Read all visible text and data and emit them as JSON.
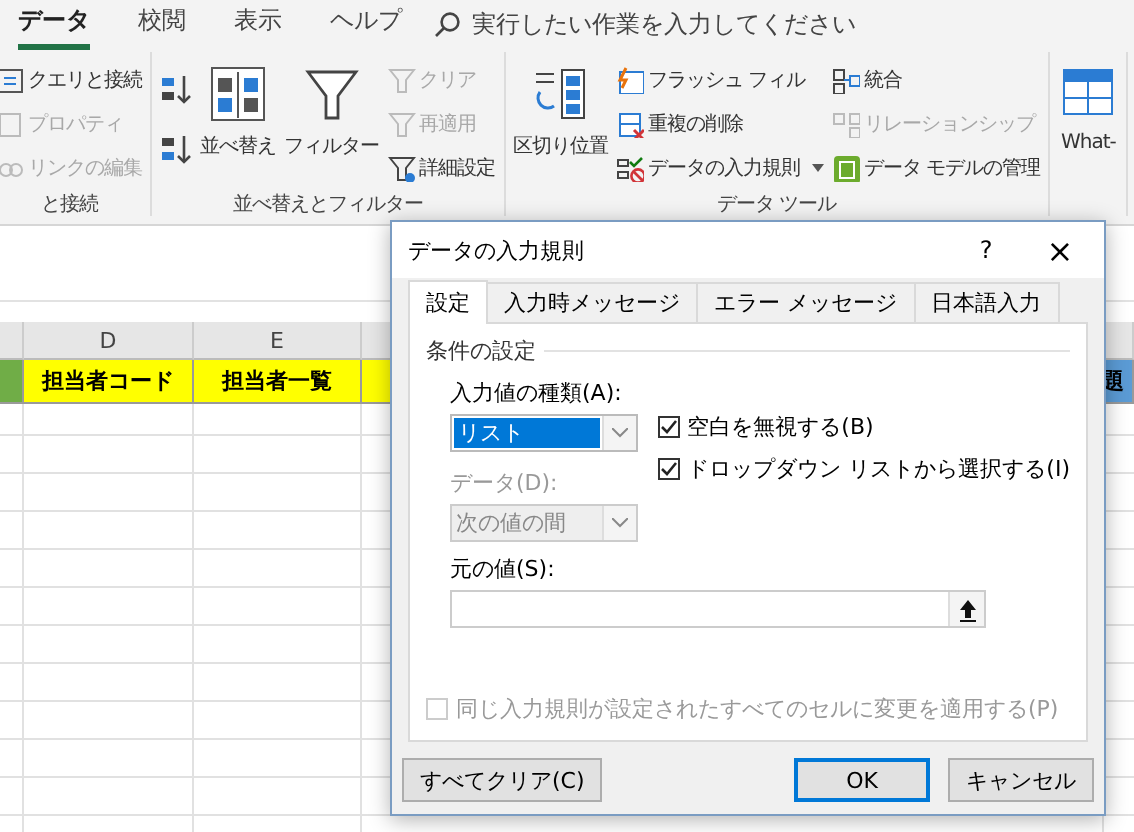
{
  "menu_tabs": [
    {
      "label": "データ",
      "selected": true
    },
    {
      "label": "校閲",
      "selected": false
    },
    {
      "label": "表示",
      "selected": false
    },
    {
      "label": "ヘルプ",
      "selected": false
    }
  ],
  "search": {
    "placeholder": "実行したい作業を入力してください"
  },
  "ribbon": {
    "groups": [
      {
        "label": "と接続",
        "columns": [
          {
            "kind": "stack",
            "items": [
              {
                "label": "クエリと接続",
                "disabled": false
              },
              {
                "label": "プロパティ",
                "disabled": true
              },
              {
                "label": "リンクの編集",
                "disabled": true
              }
            ]
          }
        ]
      },
      {
        "label": "並べ替えとフィルター",
        "columns": [
          {
            "kind": "icon_pair"
          },
          {
            "kind": "large",
            "label": "並べ替え"
          },
          {
            "kind": "large",
            "label": "フィルター"
          },
          {
            "kind": "stack",
            "items": [
              {
                "label": "クリア",
                "disabled": true
              },
              {
                "label": "再適用",
                "disabled": true
              },
              {
                "label": "詳細設定",
                "disabled": false
              }
            ]
          }
        ]
      },
      {
        "label": "データ ツール",
        "columns": [
          {
            "kind": "large",
            "label": "区切り位置"
          },
          {
            "kind": "stack",
            "items": [
              {
                "label": "フラッシュ フィル",
                "disabled": false
              },
              {
                "label": "重複の削除",
                "disabled": false
              },
              {
                "label": "データの入力規則",
                "disabled": false,
                "dropdown": true
              }
            ]
          },
          {
            "kind": "stack",
            "items": [
              {
                "label": "統合",
                "disabled": false
              },
              {
                "label": "リレーションシップ",
                "disabled": true
              },
              {
                "label": "データ モデルの管理",
                "disabled": false
              }
            ]
          }
        ]
      },
      {
        "columns": [
          {
            "kind": "large",
            "label": "What-"
          }
        ]
      }
    ]
  },
  "sheet": {
    "column_headers": [
      "D",
      "E"
    ],
    "header_row": [
      {
        "color": "#70ad47"
      },
      {
        "text": "担当者コード",
        "color": "#ffff00"
      },
      {
        "text": "担当者一覧",
        "color": "#ffff00"
      },
      {
        "color": "#ffff00"
      },
      {
        "text": "題",
        "color": "#5b9bd5"
      }
    ]
  },
  "dialog": {
    "title": "データの入力規則",
    "help": "?",
    "close": "×",
    "tabs": [
      {
        "label": "設定",
        "selected": true
      },
      {
        "label": "入力時メッセージ",
        "selected": false
      },
      {
        "label": "エラー メッセージ",
        "selected": false
      },
      {
        "label": "日本語入力",
        "selected": false
      }
    ],
    "section": "条件の設定",
    "allow": {
      "label": "入力値の種類(A):",
      "value": "リスト",
      "disabled": false
    },
    "data": {
      "label": "データ(D):",
      "value": "次の値の間",
      "disabled": true
    },
    "checkboxes": [
      {
        "label": "空白を無視する(B)",
        "checked": true,
        "disabled": false
      },
      {
        "label": "ドロップダウン リストから選択する(I)",
        "checked": true,
        "disabled": false
      }
    ],
    "source": {
      "label": "元の値(S):"
    },
    "apply_all": {
      "label": "同じ入力規則が設定されたすべてのセルに変更を適用する(P)",
      "checked": false,
      "disabled": true
    },
    "buttons": [
      {
        "label": "すべてクリア(C)",
        "default": false
      },
      {
        "label": "OK",
        "default": true
      },
      {
        "label": "キャンセル",
        "default": false
      }
    ]
  }
}
